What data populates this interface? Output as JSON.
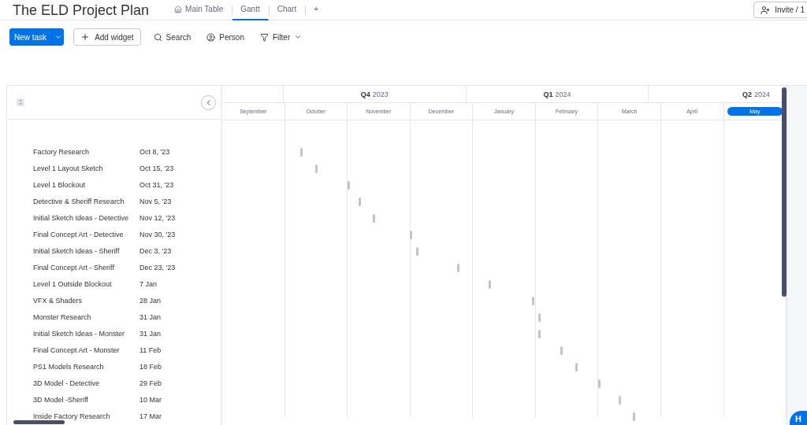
{
  "title": "The ELD Project Plan",
  "tabs": [
    {
      "label": "Main Table",
      "selected": false
    },
    {
      "label": "Gantt",
      "selected": true
    },
    {
      "label": "Chart",
      "selected": false
    }
  ],
  "add_tab": "+",
  "invite": "Invite / 1",
  "toolbar": {
    "new_task": "New task",
    "add_widget": "Add widget",
    "search": "Search",
    "person": "Person",
    "filter": "Filter"
  },
  "quarters": [
    {
      "months": [
        {
          "label": "September",
          "selected": false
        }
      ]
    },
    {
      "quarter": "Q4",
      "year": "2023",
      "months": [
        {
          "label": "October",
          "selected": false
        },
        {
          "label": "November",
          "selected": false
        },
        {
          "label": "December",
          "selected": false
        }
      ]
    },
    {
      "quarter": "Q1",
      "year": "2024",
      "months": [
        {
          "label": "January",
          "selected": false
        },
        {
          "label": "February",
          "selected": false
        },
        {
          "label": "March",
          "selected": false
        }
      ]
    },
    {
      "quarter": "Q2",
      "year": "2024",
      "months": [
        {
          "label": "April",
          "selected": false
        },
        {
          "label": "May",
          "selected": true
        }
      ]
    }
  ],
  "tasks": [
    {
      "name": "Factory Research",
      "date": "Oct 8, '23",
      "level": 0.138
    },
    {
      "name": "Level 1 Layout Sketch",
      "date": "Oct 15, '23",
      "level": 0.165
    },
    {
      "name": "Level 1 Blockout",
      "date": "Oct 31, '23",
      "level": 0.222
    },
    {
      "name": "Detective & Sheriff Research",
      "date": "Nov 5, '23",
      "level": 0.242
    },
    {
      "name": "Initial Sketch Ideas - Detective",
      "date": "Nov 12, '23",
      "level": 0.267
    },
    {
      "name": "Final Concept Art - Detective",
      "date": "Nov 30, '23",
      "level": 0.332
    },
    {
      "name": "Initial Sketch Ideas - Sheriff",
      "date": "Dec 3, '23",
      "level": 0.344
    },
    {
      "name": "Final Concept Art - Sheriff",
      "date": "Dec 23, '23",
      "level": 0.416
    },
    {
      "name": "Level 1 Outside Blockout",
      "date": "7 Jan",
      "level": 0.472
    },
    {
      "name": "VFX & Shaders",
      "date": "28 Jan",
      "level": 0.549
    },
    {
      "name": "Monster Research",
      "date": "31 Jan",
      "level": 0.56
    },
    {
      "name": "Initial Sketch Ideas - Monster",
      "date": "31 Jan",
      "level": 0.56
    },
    {
      "name": "Final Concept Art - Monster",
      "date": "11 Feb",
      "level": 0.599
    },
    {
      "name": "PS1 Models Research",
      "date": "18 Feb",
      "level": 0.626
    },
    {
      "name": "3D Model - Detective",
      "date": "29 Feb",
      "level": 0.666
    },
    {
      "name": "3D Model -Sheriff",
      "date": "10 Mar",
      "level": 0.703
    },
    {
      "name": "Inside Factory Research",
      "date": "17 Mar",
      "level": 0.728
    }
  ],
  "help": "H"
}
